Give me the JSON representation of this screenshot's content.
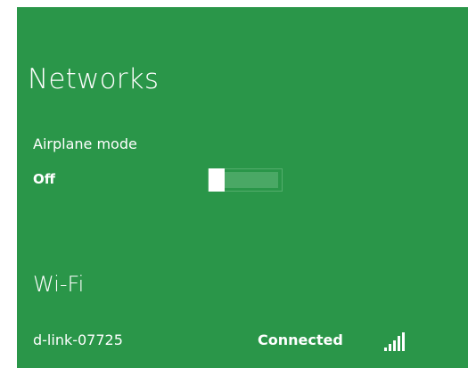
{
  "pane": {
    "title": "Networks",
    "background_color": "#2a9649"
  },
  "airplane_mode": {
    "label": "Airplane mode",
    "state": "Off",
    "enabled": false
  },
  "wifi": {
    "section_title": "Wi-Fi",
    "networks": [
      {
        "name": "d-link-07725",
        "status": "Connected",
        "signal_bars": 5,
        "icon": "wifi-signal-icon"
      }
    ]
  }
}
